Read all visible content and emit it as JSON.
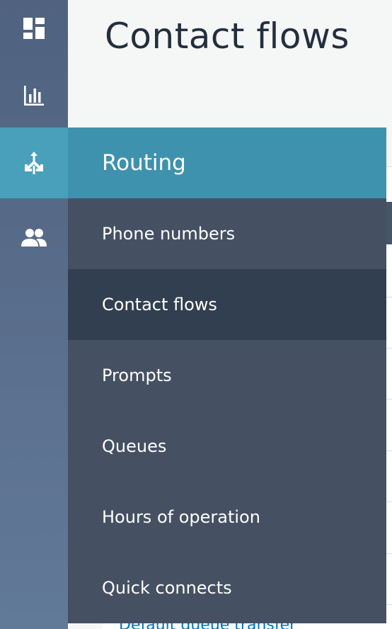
{
  "page": {
    "title": "Contact flows",
    "peek_link": "Default queue transfer"
  },
  "rail": {
    "items": [
      {
        "icon": "dashboard-icon"
      },
      {
        "icon": "metrics-icon"
      },
      {
        "icon": "routing-icon",
        "active": true
      },
      {
        "icon": "users-icon"
      }
    ]
  },
  "flyout": {
    "header": "Routing",
    "items": [
      {
        "label": "Phone numbers"
      },
      {
        "label": "Contact flows",
        "active": true
      },
      {
        "label": "Prompts"
      },
      {
        "label": "Queues"
      },
      {
        "label": "Hours of operation"
      },
      {
        "label": "Quick connects"
      }
    ]
  },
  "colors": {
    "rail": "#5a6f8d",
    "active_accent": "#48a0ba",
    "flyout_bg": "#455163",
    "flyout_active": "#323f50",
    "title_text": "#232f3e",
    "link": "#0073bb"
  }
}
